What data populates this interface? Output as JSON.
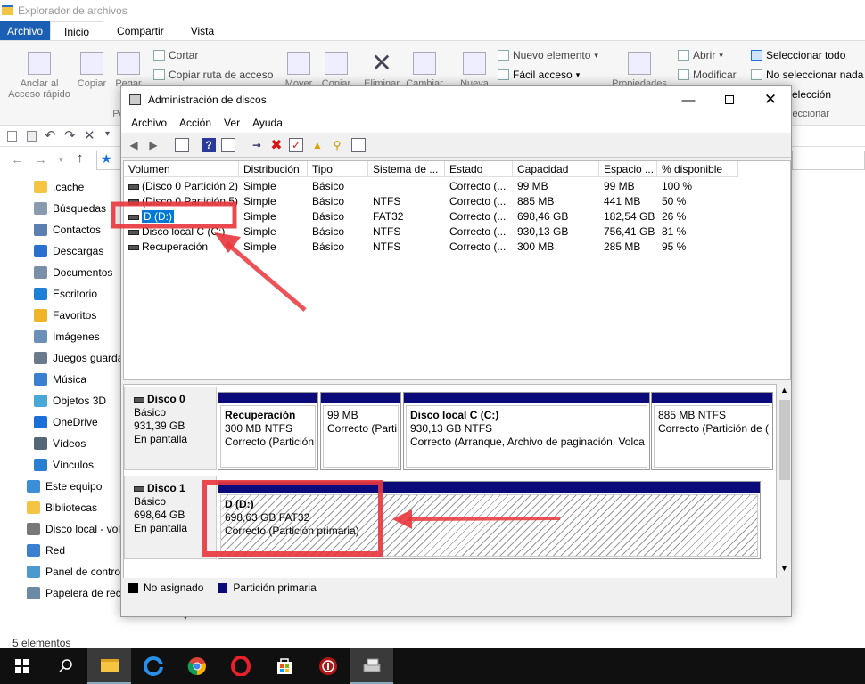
{
  "explorer": {
    "title": "Explorador de archivos",
    "tabs": [
      "Archivo",
      "Inicio",
      "Compartir",
      "Vista"
    ],
    "ribbon": {
      "pin": "Anclar al Acceso rápido",
      "copy": "Copiar",
      "paste": "Pegar",
      "cut": "Cortar",
      "copy_path": "Copiar ruta de acceso",
      "move": "Mover",
      "copy_to": "Copiar",
      "delete": "Eliminar",
      "rename": "Cambiar",
      "new": "Nueva",
      "new_item": "Nuevo elemento",
      "easy_access": "Fácil acceso",
      "properties": "Propiedades",
      "open": "Abrir",
      "modify": "Modificar",
      "select_all": "Seleccionar todo",
      "select_none": "No seleccionar nada",
      "invert": "ir selección",
      "select_group": "leccionar",
      "clipboard_group": "Po"
    },
    "nav": [
      {
        "label": ".cache",
        "color": "#f4c542"
      },
      {
        "label": "Búsquedas",
        "color": "#8a9bb0"
      },
      {
        "label": "Contactos",
        "color": "#5a7fb0"
      },
      {
        "label": "Descargas",
        "color": "#2a6fcf"
      },
      {
        "label": "Documentos",
        "color": "#7a8ea8"
      },
      {
        "label": "Escritorio",
        "color": "#1e7fd8"
      },
      {
        "label": "Favoritos",
        "color": "#f0b429"
      },
      {
        "label": "Imágenes",
        "color": "#6b8fb8"
      },
      {
        "label": "Juegos guarda",
        "color": "#6a7a8a"
      },
      {
        "label": "Música",
        "color": "#3a7fd0"
      },
      {
        "label": "Objetos 3D",
        "color": "#4aa8d8"
      },
      {
        "label": "OneDrive",
        "color": "#1a6fd8"
      },
      {
        "label": "Vídeos",
        "color": "#556677"
      },
      {
        "label": "Vínculos",
        "color": "#2a7fd0"
      },
      {
        "label": "Este equipo",
        "color": "#3a8fd8"
      },
      {
        "label": "Bibliotecas",
        "color": "#f4c542"
      },
      {
        "label": "Disco local - vol",
        "color": "#777"
      },
      {
        "label": "Red",
        "color": "#3a7fd0"
      },
      {
        "label": "Panel de contro",
        "color": "#4a9ad0"
      },
      {
        "label": "Papelera de reci",
        "color": "#6a8aa8"
      }
    ],
    "status": "5 elementos"
  },
  "dialog": {
    "title": "Administración de discos",
    "menu": [
      "Archivo",
      "Acción",
      "Ver",
      "Ayuda"
    ],
    "columns": [
      "Volumen",
      "Distribución",
      "Tipo",
      "Sistema de ...",
      "Estado",
      "Capacidad",
      "Espacio ...",
      "% disponible"
    ],
    "rows": [
      [
        "(Disco 0 Partición 2)",
        "Simple",
        "Básico",
        "",
        "Correcto (...",
        "99 MB",
        "99 MB",
        "100 %"
      ],
      [
        "(Disco 0 Partición 5)",
        "Simple",
        "Básico",
        "NTFS",
        "Correcto (...",
        "885 MB",
        "441 MB",
        "50 %"
      ],
      [
        "D (D:)",
        "Simple",
        "Básico",
        "FAT32",
        "Correcto (...",
        "698,46 GB",
        "182,54 GB",
        "26 %"
      ],
      [
        "Disco local C (C:)",
        "Simple",
        "Básico",
        "NTFS",
        "Correcto (...",
        "930,13 GB",
        "756,41 GB",
        "81 %"
      ],
      [
        "Recuperación",
        "Simple",
        "Básico",
        "NTFS",
        "Correcto (...",
        "300 MB",
        "285 MB",
        "95 %"
      ]
    ],
    "disks": [
      {
        "name": "Disco 0",
        "type": "Básico",
        "size": "931,39 GB",
        "status": "En pantalla",
        "partitions": [
          {
            "title": "Recuperación",
            "line1": "300 MB NTFS",
            "line2": "Correcto (Partición"
          },
          {
            "title": "",
            "line1": "99 MB",
            "line2": "Correcto (Parti"
          },
          {
            "title": "Disco local C  (C:)",
            "line1": "930,13 GB NTFS",
            "line2": "Correcto (Arranque, Archivo de paginación, Volca"
          },
          {
            "title": "",
            "line1": "885 MB NTFS",
            "line2": "Correcto (Partición de ("
          }
        ]
      },
      {
        "name": "Disco 1",
        "type": "Básico",
        "size": "698,64 GB",
        "status": "En pantalla",
        "partitions": [
          {
            "title": "D  (D:)",
            "line1": "698,63 GB FAT32",
            "line2": "Correcto (Partición primaria)"
          }
        ]
      }
    ],
    "legend": [
      {
        "label": "No asignado",
        "color": "#000000"
      },
      {
        "label": "Partición primaria",
        "color": "#0a0a7a"
      }
    ]
  },
  "colors": {
    "accent": "#1a5fb4",
    "annotation": "#e8363c",
    "selection": "#0078d7"
  }
}
